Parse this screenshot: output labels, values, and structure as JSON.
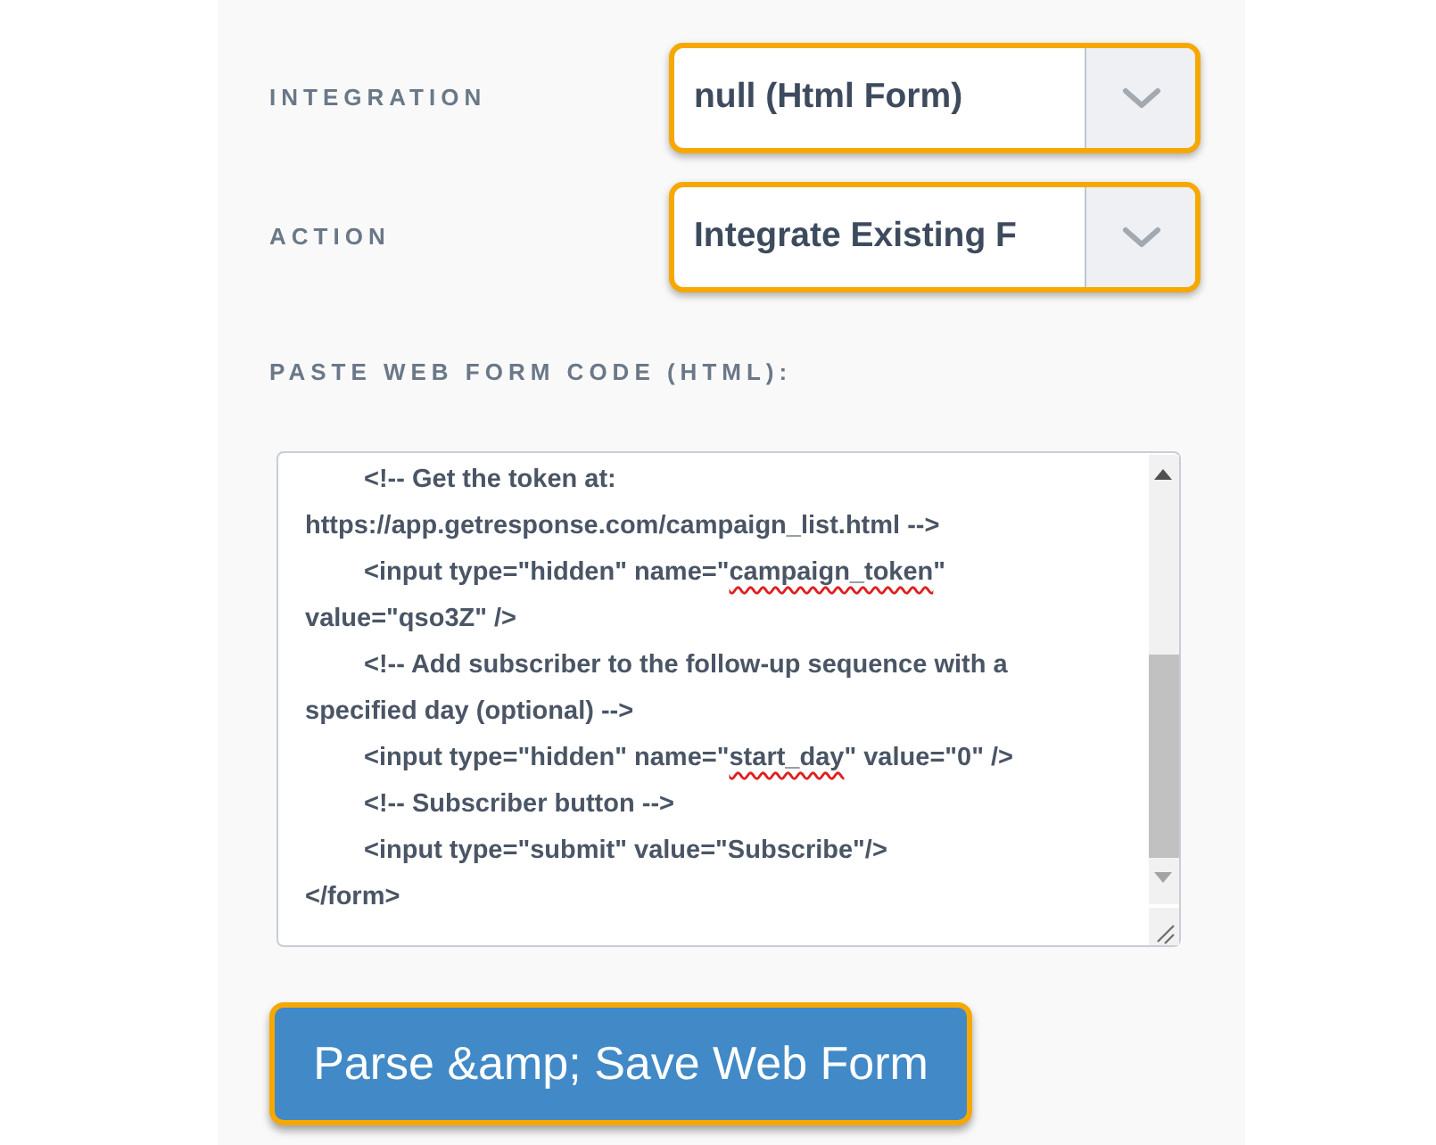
{
  "selects": [
    {
      "label": "INTEGRATION",
      "value": "null (Html Form)",
      "highlighted": true
    },
    {
      "label": "ACTION",
      "value": "Integrate Existing F",
      "highlighted": true
    }
  ],
  "web_form_code": {
    "label": "PASTE WEB FORM CODE (HTML):",
    "lines": [
      {
        "indented": true,
        "parts": [
          {
            "text": "<!-- Get the token at:",
            "misspelled": false
          }
        ]
      },
      {
        "indented": false,
        "parts": [
          {
            "text": "https://app.getresponse.com/campaign_list.html -->",
            "misspelled": false
          }
        ]
      },
      {
        "indented": true,
        "parts": [
          {
            "text": "<input type=\"hidden\" name=\"",
            "misspelled": false
          },
          {
            "text": "campaign_token",
            "misspelled": true
          },
          {
            "text": "\"",
            "misspelled": false
          }
        ]
      },
      {
        "indented": false,
        "parts": [
          {
            "text": "value=\"qso3Z\" />",
            "misspelled": false
          }
        ]
      },
      {
        "indented": true,
        "parts": [
          {
            "text": "<!-- Add subscriber to the follow-up sequence with a",
            "misspelled": false
          }
        ]
      },
      {
        "indented": false,
        "parts": [
          {
            "text": "specified day (optional) -->",
            "misspelled": false
          }
        ]
      },
      {
        "indented": true,
        "parts": [
          {
            "text": "<input type=\"hidden\" name=\"",
            "misspelled": false
          },
          {
            "text": "start_day",
            "misspelled": true
          },
          {
            "text": "\" value=\"0\" />",
            "misspelled": false
          }
        ]
      },
      {
        "indented": true,
        "parts": [
          {
            "text": "<!-- Subscriber button -->",
            "misspelled": false
          }
        ]
      },
      {
        "indented": true,
        "parts": [
          {
            "text": "<input type=\"submit\" value=\"Subscribe\"/>",
            "misspelled": false
          }
        ]
      },
      {
        "indented": false,
        "parts": [
          {
            "text": "</form>",
            "misspelled": false
          }
        ]
      }
    ]
  },
  "submit_button": {
    "label": "Parse &amp; Save Web Form",
    "highlighted": true
  }
}
